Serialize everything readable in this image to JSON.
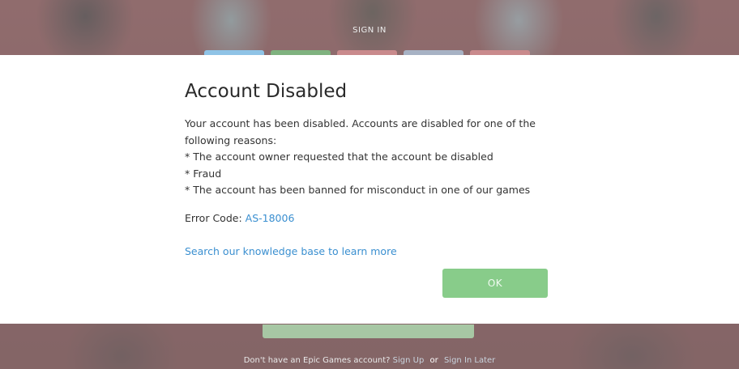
{
  "background": {
    "signin_title": "SIGN IN",
    "social_buttons": [
      {
        "name": "social-button-1",
        "color": "#8fc3e6"
      },
      {
        "name": "social-button-2",
        "color": "#7fb27f"
      },
      {
        "name": "social-button-3",
        "color": "#c98a8c"
      },
      {
        "name": "social-button-4",
        "color": "#a7b2c4"
      },
      {
        "name": "social-button-5",
        "color": "#c98a8c"
      }
    ],
    "footer": {
      "prompt": "Don't have an Epic Games account?",
      "signup_link": "Sign Up",
      "or_text": "or",
      "signin_later_link": "Sign In Later"
    }
  },
  "modal": {
    "title": "Account Disabled",
    "body_lines": [
      "Your account has been disabled.  Accounts are disabled for one of the following reasons:",
      "* The account owner requested that the account be disabled",
      "* Fraud",
      "* The account has been banned for misconduct in one of our games"
    ],
    "error_label": "Error Code: ",
    "error_code": "AS-18006",
    "kb_link": "Search our knowledge base to learn more",
    "ok_label": "OK"
  },
  "colors": {
    "ok_button": "#88cc8a",
    "link": "#3a8fd0"
  }
}
